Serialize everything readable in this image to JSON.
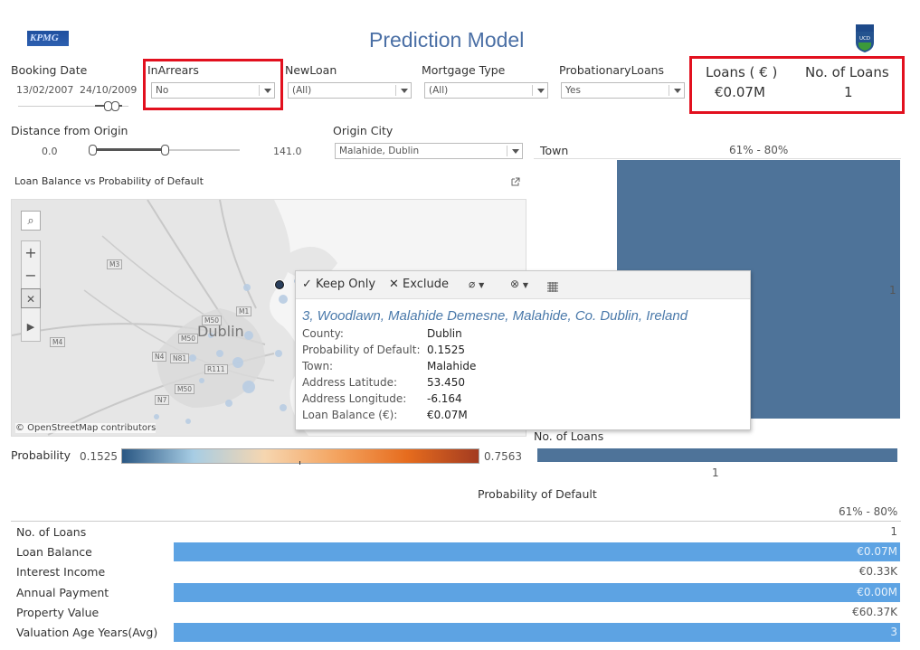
{
  "header": {
    "title": "Prediction Model",
    "left_logo": "KPMG",
    "right_logo": "UCD DUBLIN"
  },
  "filters": {
    "booking_date": {
      "label": "Booking Date",
      "start": "13/02/2007",
      "end": "24/10/2009"
    },
    "in_arrears": {
      "label": "InArrears",
      "value": "No"
    },
    "new_loan": {
      "label": "NewLoan",
      "value": "(All)"
    },
    "mortgage_type": {
      "label": "Mortgage Type",
      "value": "(All)"
    },
    "probationary_loans": {
      "label": "ProbationaryLoans",
      "value": "Yes"
    },
    "distance": {
      "label": "Distance from Origin",
      "min": "0.0",
      "max": "141.0",
      "slider_fraction": 0.58
    },
    "origin_city": {
      "label": "Origin City",
      "value": "Malahide, Dublin"
    }
  },
  "kpis": {
    "loans_label": "Loans ( € )",
    "loans_value": "€0.07M",
    "count_label": "No. of Loans",
    "count_value": "1"
  },
  "map": {
    "title": "Loan Balance vs Probability of Default",
    "attribution": "© OpenStreetMap contributors",
    "city_label": "Dublin",
    "roads": [
      "M3",
      "M50",
      "M50",
      "M4",
      "N4",
      "N81",
      "M50",
      "N7",
      "R111",
      "M1"
    ]
  },
  "tooltip": {
    "keep_only": "Keep Only",
    "exclude": "Exclude",
    "address": "3, Woodlawn, Malahide Demesne, Malahide, Co. Dublin, Ireland",
    "rows": [
      {
        "key": "County:",
        "value": "Dublin"
      },
      {
        "key": "Probability of Default:",
        "value": "0.1525"
      },
      {
        "key": "Town:",
        "value": "Malahide"
      },
      {
        "key": "Address Latitude:",
        "value": "53.450"
      },
      {
        "key": "Address Longitude:",
        "value": "-6.164"
      },
      {
        "key": "Loan Balance (€):",
        "value": "€0.07M"
      }
    ]
  },
  "legend": {
    "label": "Probability",
    "min": "0.1525",
    "max": "0.7563",
    "colors": [
      "#2a5783",
      "#a7cde4",
      "#f6d6b0",
      "#f4a460",
      "#e66c1e",
      "#a33b20"
    ]
  },
  "town_chart": {
    "title": "Town",
    "band": "61% - 80%",
    "bar_value_label": "1",
    "axis_title": "No. of Loans",
    "axis_tick": "1",
    "bar_color": "#4e7399"
  },
  "table": {
    "title": "Probability of Default",
    "column": "61% - 80%",
    "bar_color": "#5da3e3",
    "rows": [
      {
        "label": "No. of Loans",
        "value": "1",
        "bar": false
      },
      {
        "label": "Loan Balance",
        "value": "€0.07M",
        "bar": true
      },
      {
        "label": "Interest Income",
        "value": "€0.33K",
        "bar": false
      },
      {
        "label": "Annual Payment",
        "value": "€0.00M",
        "bar": true
      },
      {
        "label": "Property Value",
        "value": "€60.37K",
        "bar": false
      },
      {
        "label": "Valuation Age Years(Avg)",
        "value": "3",
        "bar": true
      }
    ]
  }
}
